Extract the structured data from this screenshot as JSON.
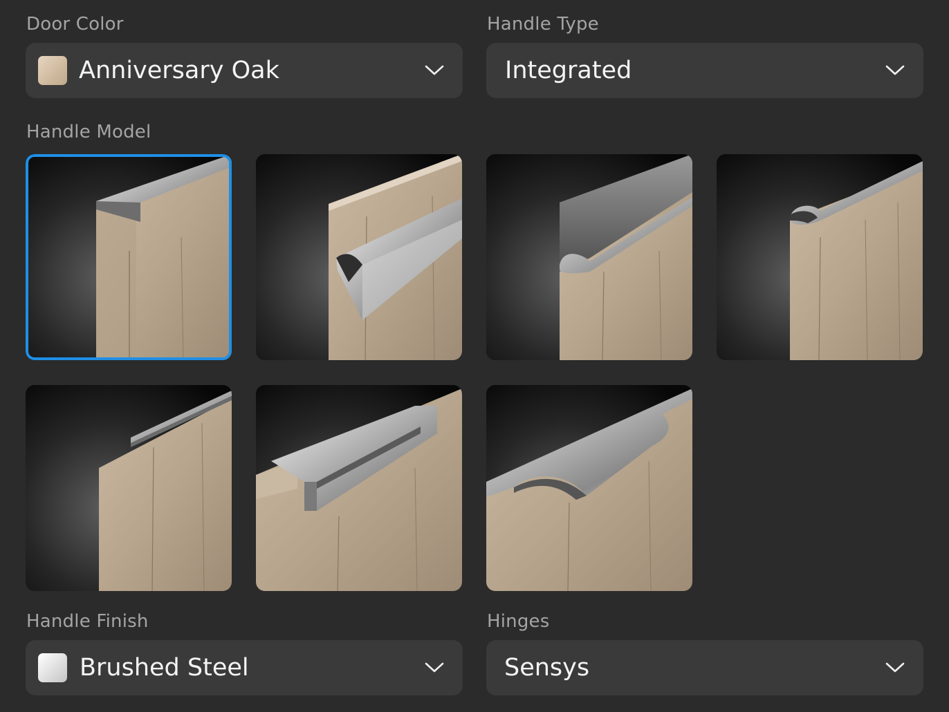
{
  "door_color": {
    "label": "Door Color",
    "value": "Anniversary Oak",
    "swatch_color": "#d8c4aa",
    "icon": "chevron-down-icon"
  },
  "handle_type": {
    "label": "Handle Type",
    "value": "Integrated",
    "icon": "chevron-down-icon"
  },
  "handle_model": {
    "label": "Handle Model",
    "selected_index": 0,
    "accent_color": "#1f8fe6",
    "options": [
      {
        "style": "l-profile-top"
      },
      {
        "style": "diagonal-notch"
      },
      {
        "style": "curved-lip"
      },
      {
        "style": "round-edge-pull"
      },
      {
        "style": "slim-edge-profile"
      },
      {
        "style": "recessed-channel"
      },
      {
        "style": "wave-flared-pull"
      }
    ]
  },
  "handle_finish": {
    "label": "Handle Finish",
    "value": "Brushed Steel",
    "swatch_color": "#e4e4e4",
    "icon": "chevron-down-icon"
  },
  "hinges": {
    "label": "Hinges",
    "value": "Sensys",
    "icon": "chevron-down-icon"
  },
  "colors": {
    "background": "#2b2b2b",
    "field": "#3a3a3a",
    "label_text": "#a4a4a4",
    "value_text": "#f4f4f4"
  }
}
